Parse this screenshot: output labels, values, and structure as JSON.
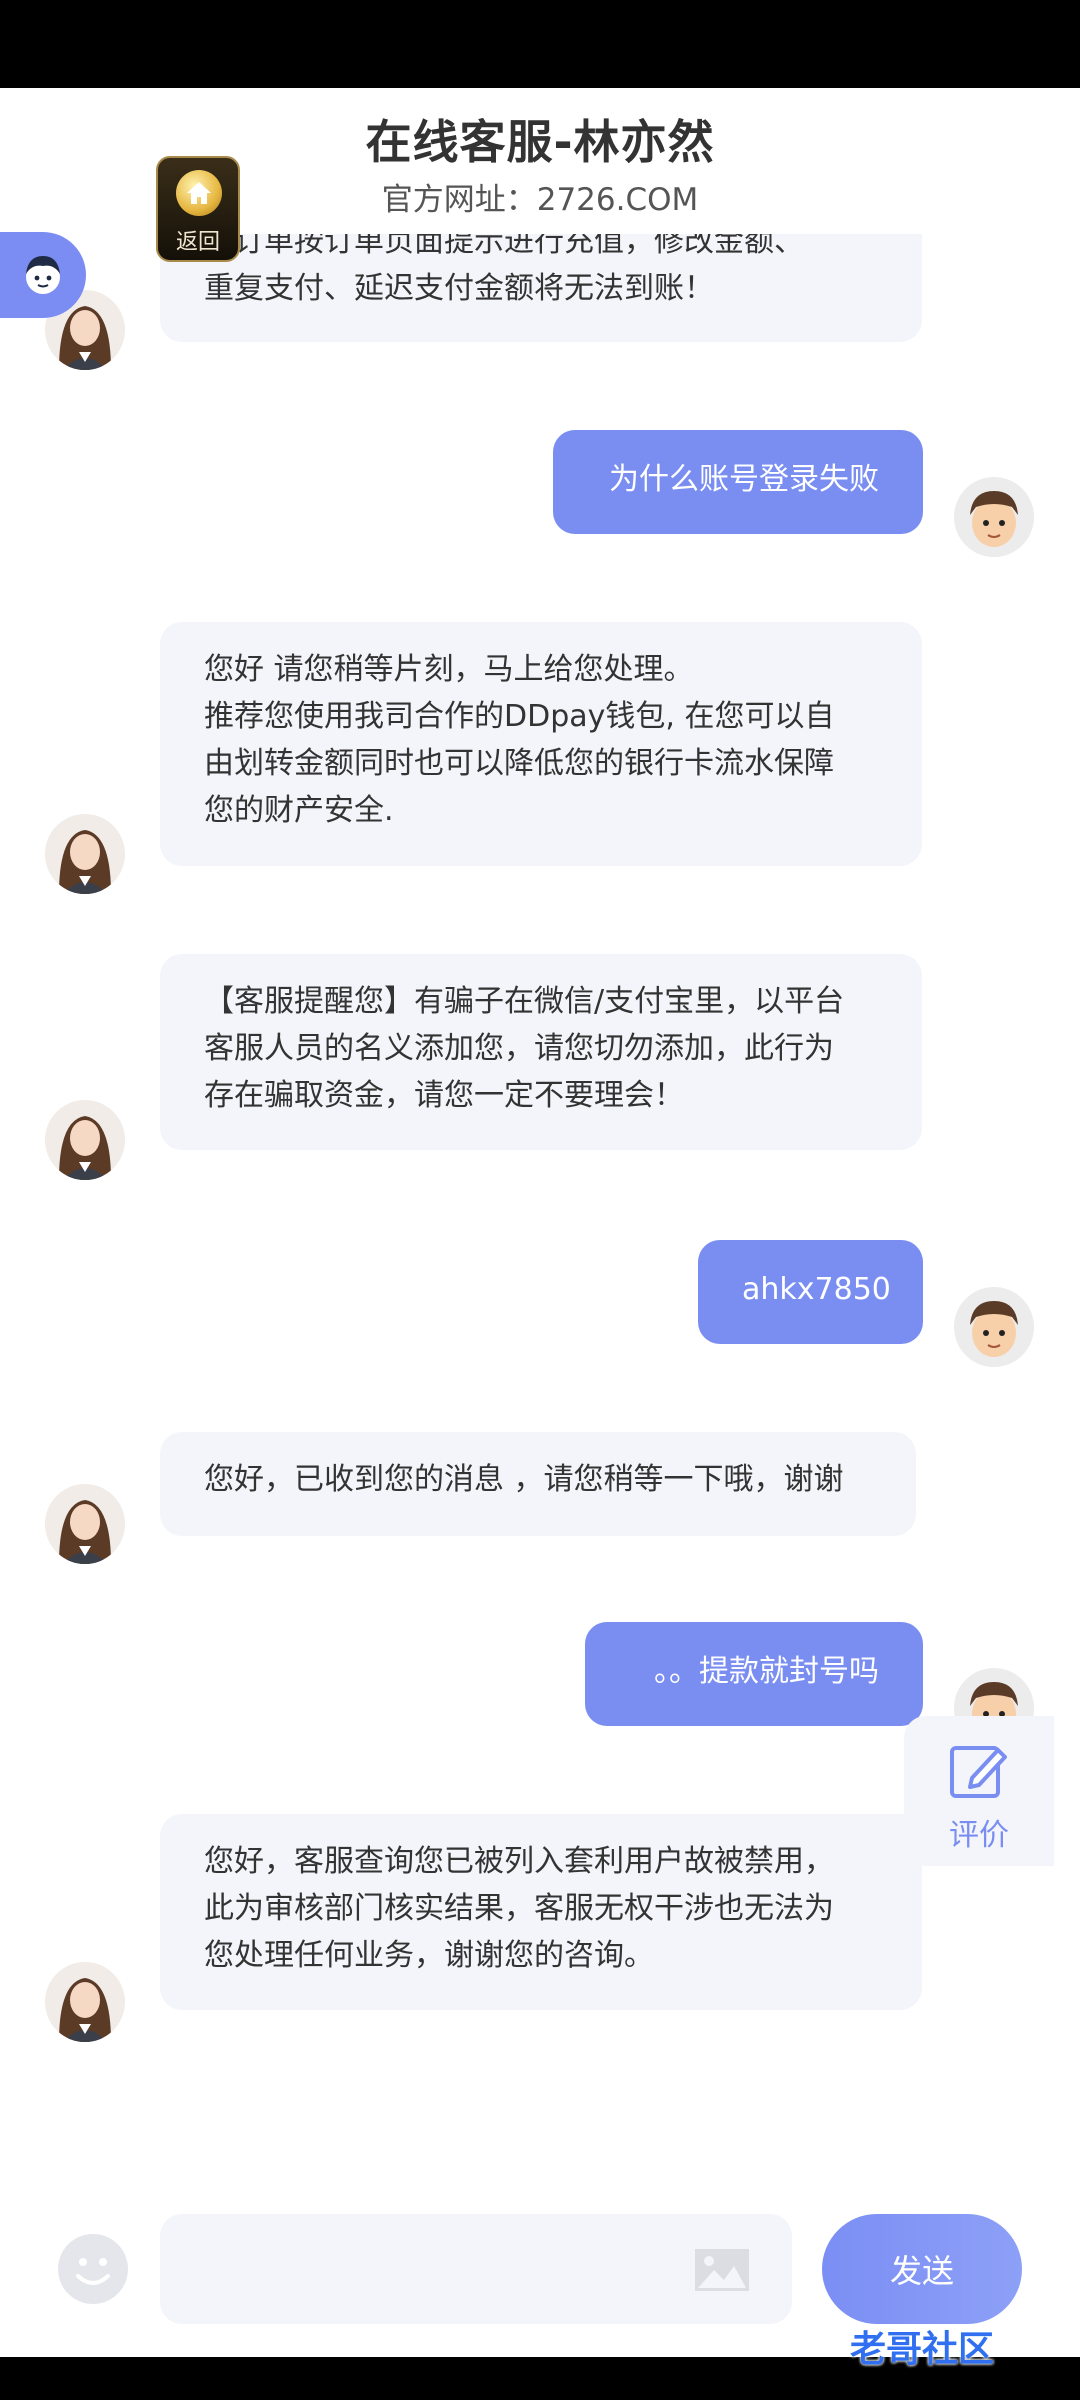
{
  "header": {
    "title": "在线客服-林亦然",
    "subtitle": "官方网址：2726.COM",
    "home_label": "返回"
  },
  "messages": [
    {
      "from": "agent",
      "lines": [
        "新订单按订单页面提示进行充值，修改金额、",
        "重复支付、延迟支付金额将无法到账！"
      ]
    },
    {
      "from": "user",
      "lines": [
        "为什么账号登录失败"
      ]
    },
    {
      "from": "agent",
      "lines": [
        "您好  请您稍等片刻，马上给您处理。",
        "推荐您使用我司合作的DDpay钱包, 在您可以自",
        "由划转金额同时也可以降低您的银行卡流水保障",
        "您的财产安全."
      ]
    },
    {
      "from": "agent",
      "lines": [
        "【客服提醒您】有骗子在微信/支付宝里，以平台",
        "客服人员的名义添加您，请您切勿添加，此行为",
        "存在骗取资金，请您一定不要理会！"
      ]
    },
    {
      "from": "user",
      "lines": [
        "ahkx7850"
      ]
    },
    {
      "from": "agent",
      "lines": [
        "您好，已收到您的消息 ，请您稍等一下哦，谢谢"
      ]
    },
    {
      "from": "user",
      "lines": [
        "。。提款就封号吗"
      ]
    },
    {
      "from": "agent",
      "lines": [
        "您好，客服查询您已被列入套利用户故被禁用，",
        "此为审核部门核实结果，客服无权干涉也无法为",
        "您处理任何业务，谢谢您的咨询。"
      ]
    }
  ],
  "side": {
    "evaluate_label": "评价"
  },
  "input": {
    "placeholder": "",
    "send_label": "发送"
  },
  "watermark": "老哥社区",
  "colors": {
    "accent": "#7a8ef2",
    "bubble_agent": "#f4f5fa",
    "background": "#ffffff"
  }
}
